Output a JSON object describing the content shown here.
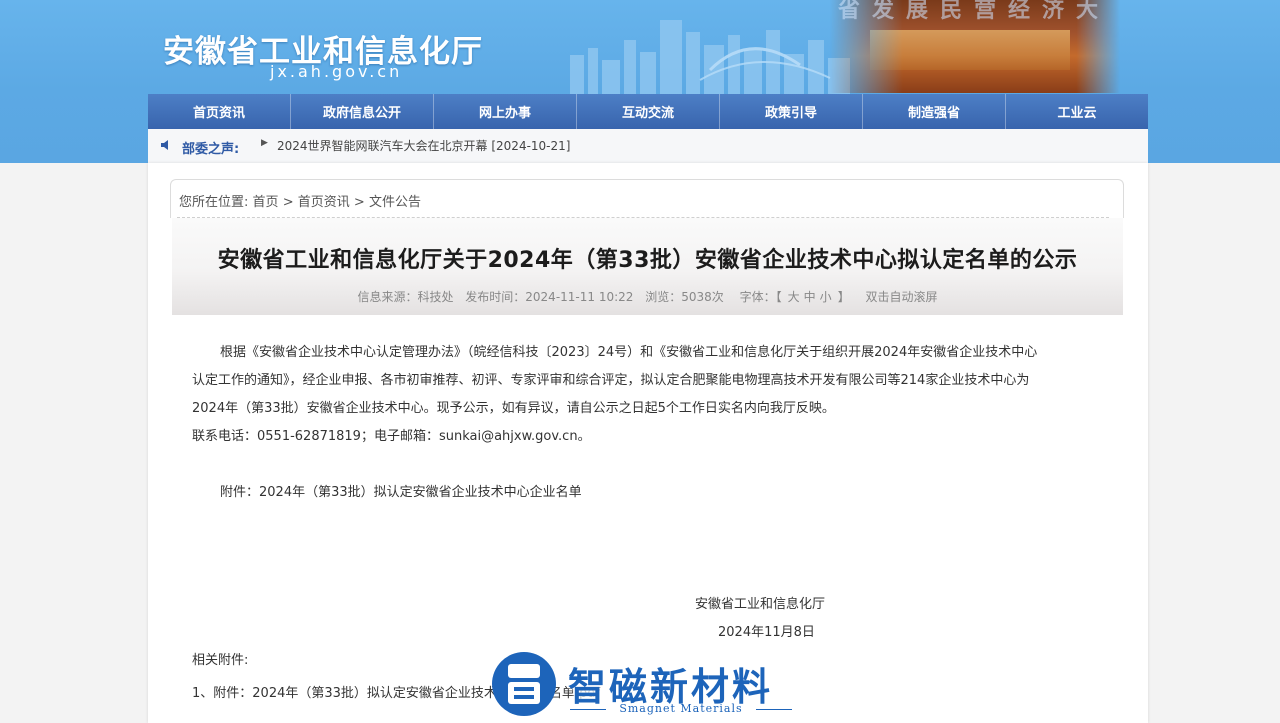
{
  "header": {
    "site_title": "安徽省工业和信息化厅",
    "site_domain": "jx.ah.gov.cn",
    "banner_slogan": "省发展民营经济大"
  },
  "nav": {
    "items": [
      "首页资讯",
      "政府信息公开",
      "网上办事",
      "互动交流",
      "政策引导",
      "制造强省",
      "工业云"
    ]
  },
  "notice": {
    "label": "部委之声:",
    "text": "2024世界智能网联汽车大会在北京开幕 [2024-10-21]"
  },
  "breadcrumb": {
    "prefix": "您所在位置:",
    "items": [
      "首页",
      "首页资讯",
      "文件公告"
    ],
    "separator": ">"
  },
  "article": {
    "title": "安徽省工业和信息化厅关于2024年（第33批）安徽省企业技术中心拟认定名单的公示",
    "meta": {
      "source": "信息来源：科技处",
      "published": "发布时间：2024-11-11 10:22",
      "views": "浏览：5038次",
      "font_label": "字体：【",
      "font_large": "大",
      "font_medium": "中",
      "font_small": "小",
      "font_close": "】",
      "autoscroll": "双击自动滚屏"
    },
    "paragraph_lines": [
      "根据《安徽省企业技术中心认定管理办法》（皖经信科技〔2023〕24号）和《安徽省工业和信息化厅关于组织开展2024年安徽省企业技术中心",
      "认定工作的通知》，经企业申报、各市初审推荐、初评、专家评审和综合评定，拟认定合肥聚能电物理高技术开发有限公司等214家企业技术中心为",
      "2024年（第33批）安徽省企业技术中心。现予公示，如有异议，请自公示之日起5个工作日实名内向我厅反映。"
    ],
    "contact": "联系电话：0551-62871819；电子邮箱：sunkai@ahjxw.gov.cn。",
    "attachment": "附件：2024年（第33批）拟认定安徽省企业技术中心企业名单",
    "signature_org": "安徽省工业和信息化厅",
    "signature_date": "2024年11月8日",
    "related_label": "相关附件:",
    "related_items": [
      "1、附件：2024年（第33批）拟认定安徽省企业技术中心企业名单.pdf"
    ]
  },
  "watermark": {
    "name": "智磁新材料",
    "subtitle": "Smagnet Materials"
  },
  "colors": {
    "header_blue": "#5ca9e4",
    "nav_blue": "#3864ad",
    "notice_label": "#2f5aa5",
    "watermark_blue": "#1d64ba"
  }
}
